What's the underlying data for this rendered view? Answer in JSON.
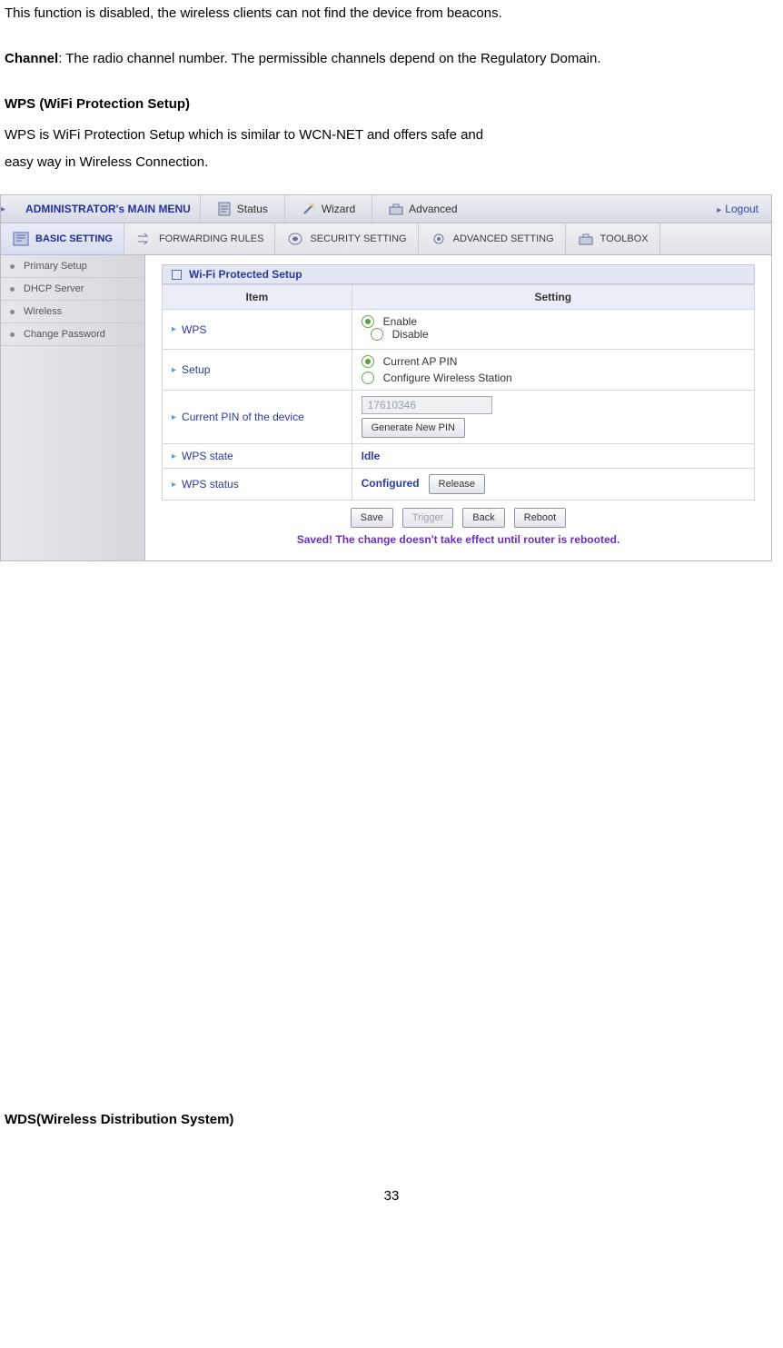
{
  "doc": {
    "p1": "This function is disabled, the wireless clients can not find the device from beacons.",
    "p2_label": "Channel",
    "p2_body": ": The radio channel number. The permissible channels depend on the Regulatory Domain.",
    "h1": "WPS (WiFi Protection Setup)",
    "p3a": "WPS is WiFi Protection Setup which is similar to WCN-NET and offers safe and",
    "p3b": "easy way in Wireless Connection.",
    "h2": "WDS(Wireless Distribution System)",
    "page_num": "33"
  },
  "ui": {
    "admin_title": "ADMINISTRATOR's MAIN MENU",
    "top": {
      "status": "Status",
      "wizard": "Wizard",
      "advanced": "Advanced",
      "logout": "Logout"
    },
    "tabs": {
      "basic": "BASIC SETTING",
      "forwarding": "FORWARDING RULES",
      "security": "SECURITY SETTING",
      "advanced": "ADVANCED SETTING",
      "toolbox": "TOOLBOX"
    },
    "sidebar": [
      "Primary Setup",
      "DHCP Server",
      "Wireless",
      "Change Password"
    ],
    "panel_title": "Wi-Fi Protected Setup",
    "headers": {
      "item": "Item",
      "setting": "Setting"
    },
    "rows": {
      "wps_label": "WPS",
      "enable": "Enable",
      "disable": "Disable",
      "setup_label": "Setup",
      "setup_opt1": "Current AP PIN",
      "setup_opt2": "Configure Wireless Station",
      "pin_label": "Current PIN of the device",
      "pin_value": "17610346",
      "gen_btn": "Generate New PIN",
      "state_label": "WPS state",
      "state_val": "Idle",
      "status_label": "WPS status",
      "status_val": "Configured",
      "release_btn": "Release"
    },
    "buttons": {
      "save": "Save",
      "trigger": "Trigger",
      "back": "Back",
      "reboot": "Reboot"
    },
    "save_msg": "Saved! The change doesn't take effect until router is rebooted."
  }
}
